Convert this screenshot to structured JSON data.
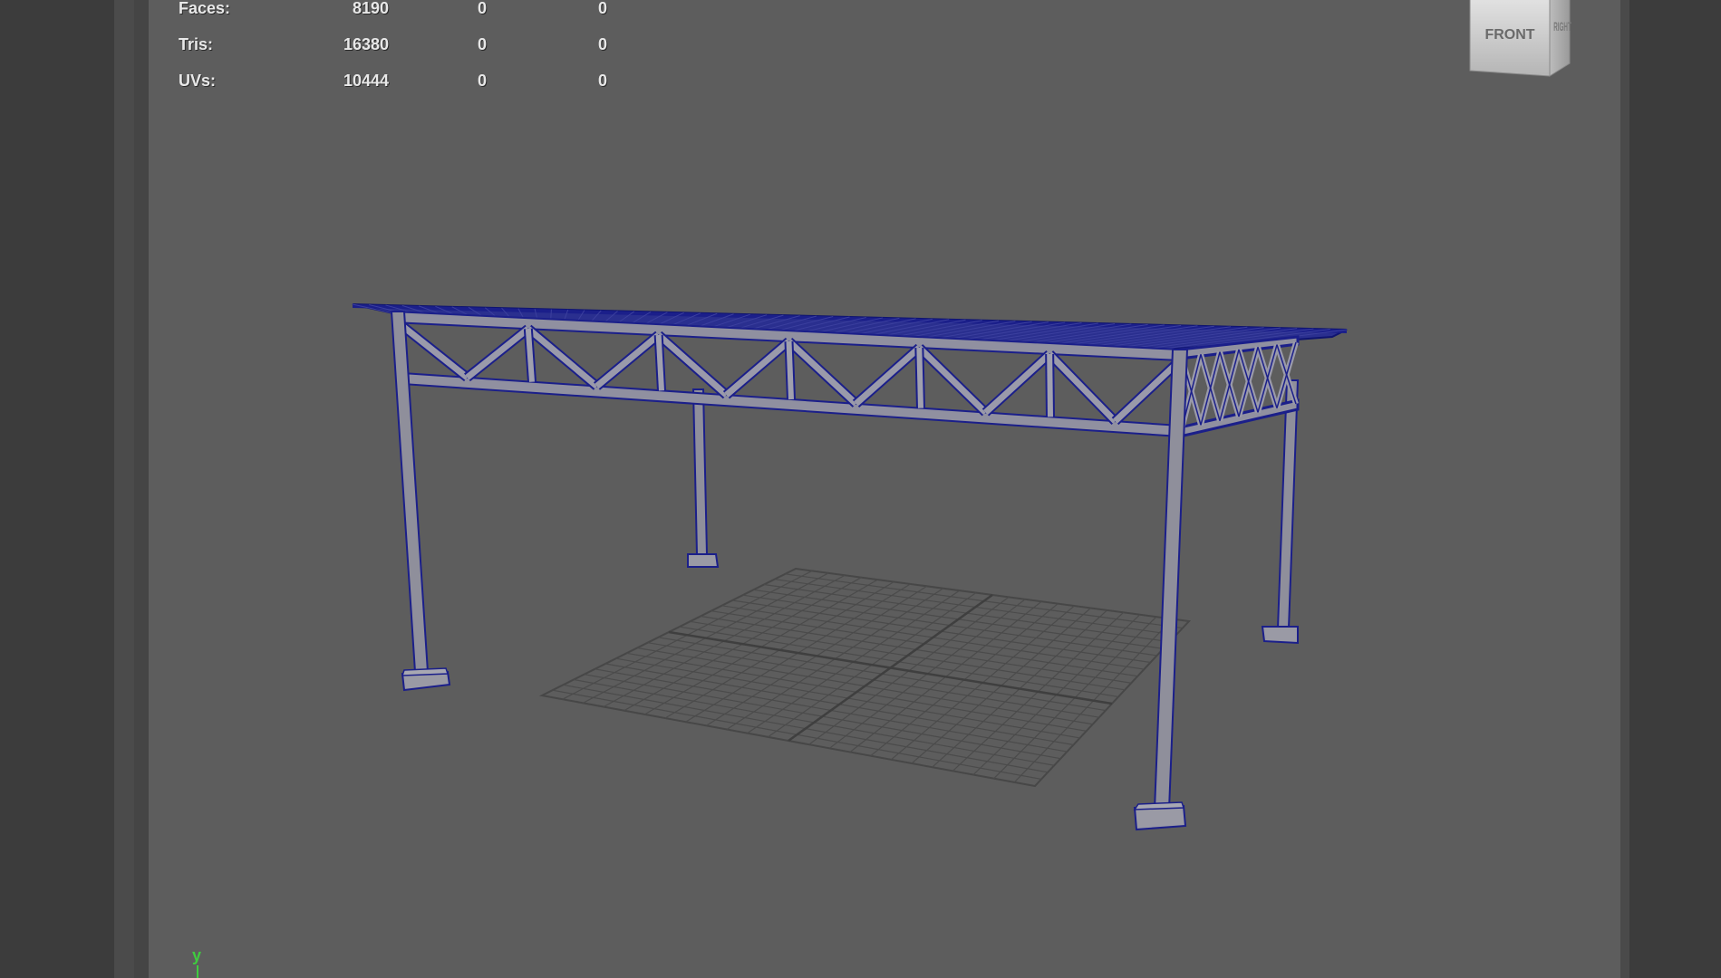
{
  "hud": {
    "rows": [
      {
        "label": "Faces:",
        "v1": "8190",
        "v2": "0",
        "v3": "0"
      },
      {
        "label": "Tris:",
        "v1": "16380",
        "v2": "0",
        "v3": "0"
      },
      {
        "label": "UVs:",
        "v1": "10444",
        "v2": "0",
        "v3": "0"
      }
    ]
  },
  "viewcube": {
    "front_label": "FRONT",
    "side_label": "RIGHT"
  },
  "axis": {
    "y_label": "y"
  },
  "colors": {
    "viewport_bg": "#5d5d5d",
    "selection_blue": "#1b1f8a",
    "grid": "#4a4a4a",
    "model_gray": "#8e8e9a",
    "axis_green": "#3fcc3f"
  },
  "icons": [
    "viewcube-icon",
    "y-axis-indicator-icon"
  ]
}
